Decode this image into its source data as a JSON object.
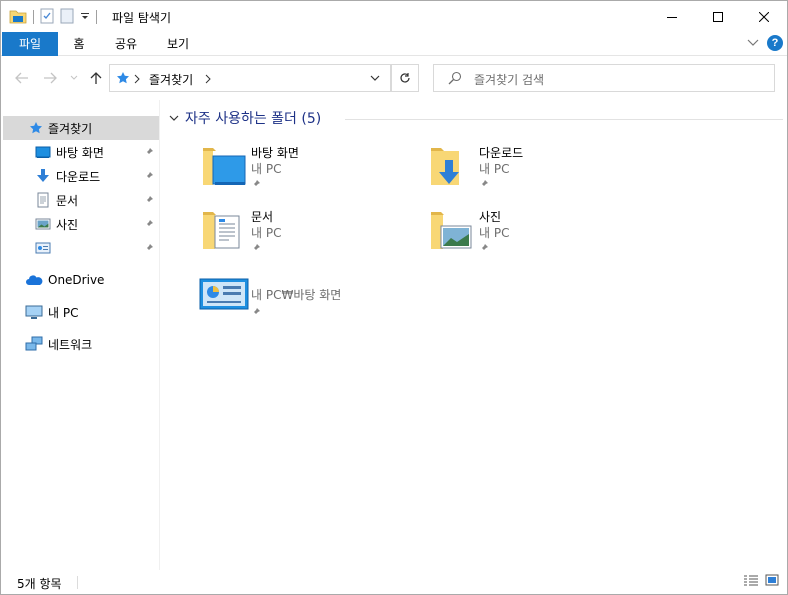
{
  "window": {
    "title": "파일 탐색기"
  },
  "ribbon": {
    "tabs": [
      {
        "label": "파일"
      },
      {
        "label": "홈"
      },
      {
        "label": "공유"
      },
      {
        "label": "보기"
      }
    ],
    "help": "?"
  },
  "address": {
    "crumb": "즐겨찾기",
    "search_placeholder": "즐겨찾기 검색"
  },
  "sidebar": {
    "items": [
      {
        "label": "즐겨찾기",
        "icon": "star-icon"
      },
      {
        "label": "바탕 화면",
        "icon": "desktop-icon",
        "pinned": true
      },
      {
        "label": "다운로드",
        "icon": "download-icon",
        "pinned": true
      },
      {
        "label": "문서",
        "icon": "document-icon",
        "pinned": true
      },
      {
        "label": "사진",
        "icon": "picture-icon",
        "pinned": true
      },
      {
        "label": "",
        "icon": "control-panel-icon",
        "pinned": true
      },
      {
        "label": "OneDrive",
        "icon": "onedrive-icon"
      },
      {
        "label": "내 PC",
        "icon": "pc-icon"
      },
      {
        "label": "네트워크",
        "icon": "network-icon"
      }
    ]
  },
  "content": {
    "group_title": "자주 사용하는 폴더 (5)",
    "tiles": [
      {
        "name": "바탕 화면",
        "sub": "내 PC"
      },
      {
        "name": "다운로드",
        "sub": "내 PC"
      },
      {
        "name": "문서",
        "sub": "내 PC"
      },
      {
        "name": "사진",
        "sub": "내 PC"
      },
      {
        "name": "내 PC₩바탕 화면",
        "sub": ""
      }
    ]
  },
  "status": {
    "count": "5개 항목"
  },
  "colors": {
    "accent": "#1979ca",
    "group_title": "#1e3287",
    "folder": "#f8d775"
  }
}
